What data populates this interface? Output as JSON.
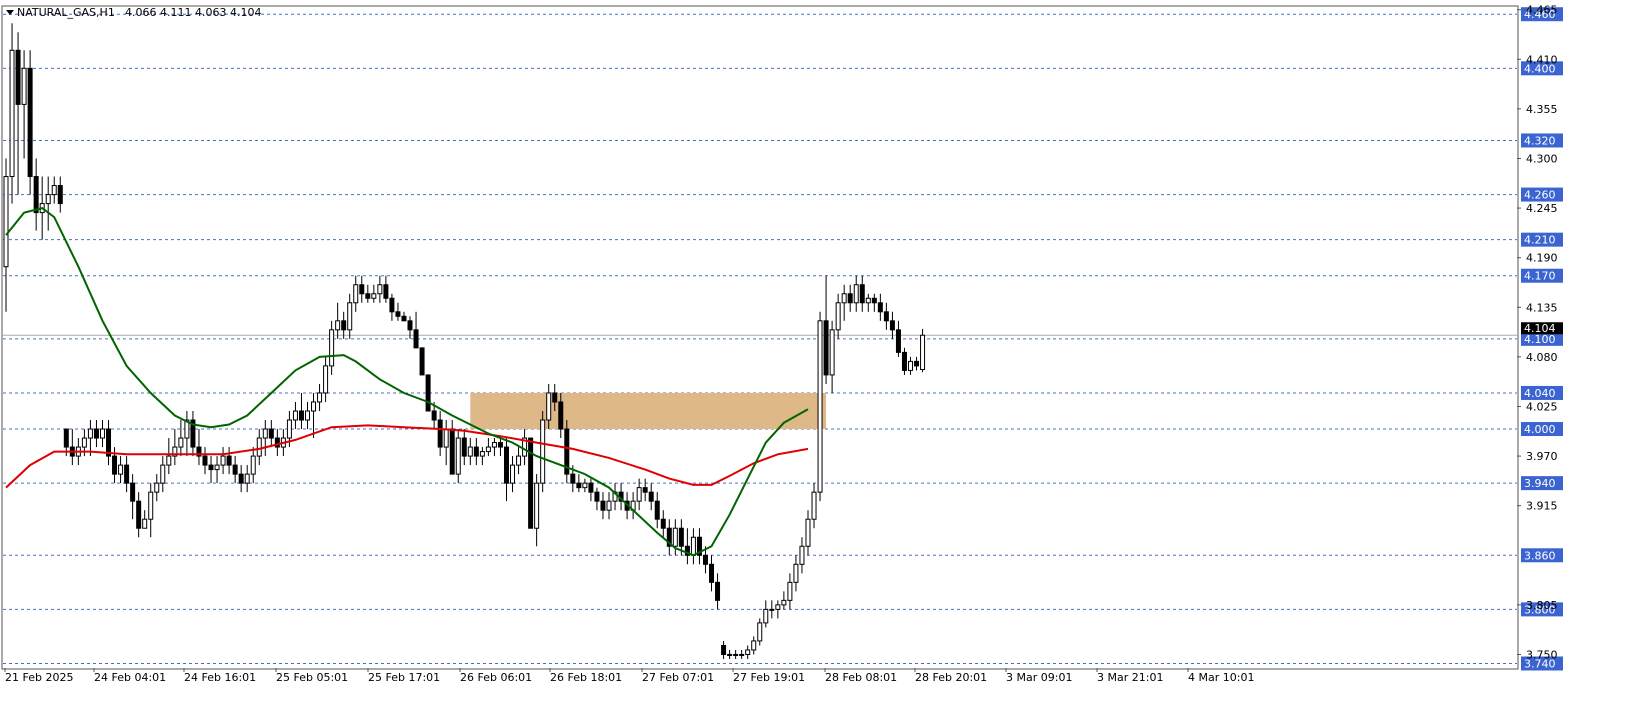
{
  "chart_data": {
    "type": "candlestick",
    "header": {
      "symbol_timeframe": "NATURAL_GAS,H1",
      "open": "4.066",
      "high": "4.111",
      "low": "4.063",
      "close": "4.104",
      "dropdown_icon": "triangle-down-icon"
    },
    "current_price": "4.104",
    "ylim": [
      3.735,
      4.468
    ],
    "y_ticks": [
      "4.465",
      "4.410",
      "4.355",
      "4.300",
      "4.245",
      "4.190",
      "4.135",
      "4.080",
      "4.025",
      "3.970",
      "3.915",
      "3.805",
      "3.750"
    ],
    "horizontal_levels": [
      {
        "value": 4.46,
        "label": "4.460"
      },
      {
        "value": 4.4,
        "label": "4.400"
      },
      {
        "value": 4.32,
        "label": "4.320"
      },
      {
        "value": 4.26,
        "label": "4.260"
      },
      {
        "value": 4.21,
        "label": "4.210"
      },
      {
        "value": 4.17,
        "label": "4.170"
      },
      {
        "value": 4.1,
        "label": "4.100"
      },
      {
        "value": 4.04,
        "label": "4.040"
      },
      {
        "value": 4.0,
        "label": "4.000"
      },
      {
        "value": 3.94,
        "label": "3.940"
      },
      {
        "value": 3.86,
        "label": "3.860"
      },
      {
        "value": 3.8,
        "label": "3.800"
      },
      {
        "value": 3.74,
        "label": "3.740"
      }
    ],
    "x_labels": [
      "21 Feb 2025",
      "24 Feb 04:01",
      "24 Feb 16:01",
      "25 Feb 05:01",
      "25 Feb 17:01",
      "26 Feb 06:01",
      "26 Feb 18:01",
      "27 Feb 07:01",
      "27 Feb 19:01",
      "28 Feb 08:01",
      "28 Feb 20:01",
      "3 Mar 09:01",
      "3 Mar 21:01",
      "4 Mar 10:01"
    ],
    "zone": {
      "from": 4.0,
      "to": 4.04,
      "start_bar": 77,
      "end_bar": 136,
      "color": "#deb887"
    },
    "ma_fast": {
      "color": "#006400",
      "points": [
        [
          0,
          4.215
        ],
        [
          3,
          4.24
        ],
        [
          6,
          4.245
        ],
        [
          8,
          4.235
        ],
        [
          12,
          4.18
        ],
        [
          16,
          4.12
        ],
        [
          20,
          4.07
        ],
        [
          24,
          4.04
        ],
        [
          28,
          4.015
        ],
        [
          31,
          4.005
        ],
        [
          34,
          4.002
        ],
        [
          37,
          4.005
        ],
        [
          40,
          4.015
        ],
        [
          44,
          4.04
        ],
        [
          48,
          4.065
        ],
        [
          52,
          4.08
        ],
        [
          56,
          4.082
        ],
        [
          58,
          4.075
        ],
        [
          62,
          4.055
        ],
        [
          66,
          4.04
        ],
        [
          70,
          4.03
        ],
        [
          74,
          4.015
        ],
        [
          77,
          4.005
        ],
        [
          80,
          3.995
        ],
        [
          84,
          3.985
        ],
        [
          88,
          3.97
        ],
        [
          92,
          3.96
        ],
        [
          96,
          3.95
        ],
        [
          100,
          3.935
        ],
        [
          104,
          3.91
        ],
        [
          108,
          3.885
        ],
        [
          111,
          3.868
        ],
        [
          114,
          3.86
        ],
        [
          117,
          3.87
        ],
        [
          120,
          3.905
        ],
        [
          123,
          3.945
        ],
        [
          126,
          3.985
        ],
        [
          129,
          4.007
        ],
        [
          133,
          4.022
        ]
      ]
    },
    "ma_slow": {
      "color": "#e00000",
      "points": [
        [
          0,
          3.935
        ],
        [
          4,
          3.96
        ],
        [
          8,
          3.975
        ],
        [
          14,
          3.975
        ],
        [
          20,
          3.972
        ],
        [
          28,
          3.972
        ],
        [
          36,
          3.972
        ],
        [
          42,
          3.978
        ],
        [
          48,
          3.988
        ],
        [
          54,
          4.002
        ],
        [
          60,
          4.004
        ],
        [
          66,
          4.002
        ],
        [
          72,
          4.0
        ],
        [
          76,
          3.998
        ],
        [
          82,
          3.992
        ],
        [
          88,
          3.985
        ],
        [
          94,
          3.978
        ],
        [
          100,
          3.968
        ],
        [
          106,
          3.955
        ],
        [
          110,
          3.945
        ],
        [
          114,
          3.938
        ],
        [
          117,
          3.938
        ],
        [
          120,
          3.948
        ],
        [
          124,
          3.962
        ],
        [
          128,
          3.972
        ],
        [
          133,
          3.978
        ]
      ]
    },
    "candles": [
      [
        4.18,
        4.3,
        4.13,
        4.28
      ],
      [
        4.28,
        4.45,
        4.25,
        4.42
      ],
      [
        4.42,
        4.44,
        4.26,
        4.36
      ],
      [
        4.36,
        4.42,
        4.3,
        4.4
      ],
      [
        4.4,
        4.42,
        4.26,
        4.28
      ],
      [
        4.28,
        4.3,
        4.22,
        4.24
      ],
      [
        4.24,
        4.28,
        4.21,
        4.25
      ],
      [
        4.25,
        4.28,
        4.22,
        4.26
      ],
      [
        4.26,
        4.28,
        4.25,
        4.27
      ],
      [
        4.27,
        4.28,
        4.24,
        4.25
      ],
      [
        4.0,
        4.0,
        3.97,
        3.98
      ],
      [
        3.98,
        4.0,
        3.96,
        3.97
      ],
      [
        3.97,
        3.99,
        3.96,
        3.98
      ],
      [
        3.98,
        4.0,
        3.97,
        3.99
      ],
      [
        3.99,
        4.01,
        3.97,
        4.0
      ],
      [
        4.0,
        4.01,
        3.98,
        3.99
      ],
      [
        3.99,
        4.01,
        3.98,
        4.0
      ],
      [
        4.0,
        4.01,
        3.96,
        3.97
      ],
      [
        3.97,
        3.98,
        3.94,
        3.95
      ],
      [
        3.95,
        3.97,
        3.94,
        3.96
      ],
      [
        3.96,
        3.97,
        3.93,
        3.94
      ],
      [
        3.94,
        3.95,
        3.9,
        3.92
      ],
      [
        3.92,
        3.93,
        3.88,
        3.89
      ],
      [
        3.89,
        3.91,
        3.89,
        3.9
      ],
      [
        3.9,
        3.94,
        3.88,
        3.93
      ],
      [
        3.93,
        3.95,
        3.92,
        3.94
      ],
      [
        3.94,
        3.97,
        3.93,
        3.96
      ],
      [
        3.96,
        3.99,
        3.95,
        3.97
      ],
      [
        3.97,
        4.0,
        3.96,
        3.98
      ],
      [
        3.98,
        4.01,
        3.97,
        3.99
      ],
      [
        3.99,
        4.02,
        3.97,
        4.01
      ],
      [
        4.01,
        4.02,
        3.97,
        3.98
      ],
      [
        3.98,
        4.0,
        3.96,
        3.97
      ],
      [
        3.97,
        3.98,
        3.95,
        3.96
      ],
      [
        3.96,
        3.97,
        3.94,
        3.955
      ],
      [
        3.955,
        3.97,
        3.94,
        3.96
      ],
      [
        3.96,
        3.98,
        3.95,
        3.97
      ],
      [
        3.97,
        3.98,
        3.95,
        3.96
      ],
      [
        3.96,
        3.97,
        3.94,
        3.95
      ],
      [
        3.95,
        3.96,
        3.93,
        3.94
      ],
      [
        3.94,
        3.96,
        3.93,
        3.95
      ],
      [
        3.95,
        3.98,
        3.94,
        3.97
      ],
      [
        3.97,
        4.0,
        3.96,
        3.99
      ],
      [
        3.99,
        4.01,
        3.97,
        4.0
      ],
      [
        4.0,
        4.01,
        3.98,
        3.99
      ],
      [
        3.99,
        4.0,
        3.97,
        3.98
      ],
      [
        3.98,
        4.0,
        3.97,
        3.99
      ],
      [
        3.99,
        4.02,
        3.98,
        4.01
      ],
      [
        4.01,
        4.03,
        4.0,
        4.02
      ],
      [
        4.02,
        4.04,
        4.0,
        4.01
      ],
      [
        4.01,
        4.03,
        4.0,
        4.02
      ],
      [
        4.02,
        4.04,
        3.99,
        4.03
      ],
      [
        4.03,
        4.05,
        4.02,
        4.04
      ],
      [
        4.04,
        4.08,
        4.03,
        4.07
      ],
      [
        4.07,
        4.12,
        4.06,
        4.11
      ],
      [
        4.11,
        4.14,
        4.1,
        4.12
      ],
      [
        4.12,
        4.13,
        4.1,
        4.11
      ],
      [
        4.11,
        4.15,
        4.1,
        4.14
      ],
      [
        4.14,
        4.17,
        4.13,
        4.16
      ],
      [
        4.16,
        4.17,
        4.14,
        4.15
      ],
      [
        4.15,
        4.16,
        4.14,
        4.145
      ],
      [
        4.145,
        4.16,
        4.14,
        4.15
      ],
      [
        4.15,
        4.17,
        4.14,
        4.16
      ],
      [
        4.16,
        4.17,
        4.14,
        4.145
      ],
      [
        4.145,
        4.15,
        4.12,
        4.13
      ],
      [
        4.13,
        4.14,
        4.12,
        4.125
      ],
      [
        4.125,
        4.13,
        4.12,
        4.12
      ],
      [
        4.12,
        4.125,
        4.1,
        4.11
      ],
      [
        4.11,
        4.13,
        4.09,
        4.09
      ],
      [
        4.09,
        4.09,
        4.06,
        4.06
      ],
      [
        4.06,
        4.06,
        4.02,
        4.02
      ],
      [
        4.02,
        4.03,
        4.0,
        4.01
      ],
      [
        4.01,
        4.02,
        3.97,
        3.98
      ],
      [
        3.98,
        4.01,
        3.96,
        4.0
      ],
      [
        4.0,
        4.01,
        3.95,
        3.95
      ],
      [
        3.95,
        4.0,
        3.94,
        3.99
      ],
      [
        3.99,
        4.0,
        3.96,
        3.97
      ],
      [
        3.97,
        3.99,
        3.96,
        3.98
      ],
      [
        3.98,
        3.99,
        3.96,
        3.97
      ],
      [
        3.97,
        3.98,
        3.96,
        3.975
      ],
      [
        3.975,
        3.99,
        3.97,
        3.98
      ],
      [
        3.98,
        3.99,
        3.97,
        3.985
      ],
      [
        3.985,
        3.99,
        3.97,
        3.98
      ],
      [
        3.98,
        3.99,
        3.92,
        3.94
      ],
      [
        3.94,
        3.97,
        3.93,
        3.96
      ],
      [
        3.96,
        3.98,
        3.95,
        3.97
      ],
      [
        3.97,
        4.0,
        3.96,
        3.99
      ],
      [
        3.99,
        3.99,
        3.92,
        3.89
      ],
      [
        3.89,
        3.95,
        3.87,
        3.94
      ],
      [
        3.94,
        4.02,
        3.93,
        4.01
      ],
      [
        4.01,
        4.05,
        4.0,
        4.04
      ],
      [
        4.04,
        4.05,
        4.02,
        4.03
      ],
      [
        4.03,
        4.04,
        3.99,
        4.0
      ],
      [
        4.0,
        4.01,
        3.94,
        3.95
      ],
      [
        3.95,
        3.96,
        3.93,
        3.94
      ],
      [
        3.94,
        3.95,
        3.93,
        3.935
      ],
      [
        3.935,
        3.945,
        3.93,
        3.94
      ],
      [
        3.94,
        3.945,
        3.92,
        3.93
      ],
      [
        3.93,
        3.935,
        3.91,
        3.92
      ],
      [
        3.92,
        3.93,
        3.9,
        3.91
      ],
      [
        3.91,
        3.93,
        3.9,
        3.92
      ],
      [
        3.92,
        3.94,
        3.91,
        3.93
      ],
      [
        3.93,
        3.94,
        3.91,
        3.92
      ],
      [
        3.92,
        3.93,
        3.9,
        3.91
      ],
      [
        3.91,
        3.93,
        3.9,
        3.92
      ],
      [
        3.92,
        3.945,
        3.91,
        3.935
      ],
      [
        3.935,
        3.945,
        3.92,
        3.93
      ],
      [
        3.93,
        3.94,
        3.91,
        3.92
      ],
      [
        3.92,
        3.93,
        3.89,
        3.9
      ],
      [
        3.9,
        3.91,
        3.88,
        3.89
      ],
      [
        3.89,
        3.9,
        3.86,
        3.87
      ],
      [
        3.87,
        3.9,
        3.86,
        3.89
      ],
      [
        3.89,
        3.9,
        3.86,
        3.87
      ],
      [
        3.87,
        3.89,
        3.85,
        3.86
      ],
      [
        3.86,
        3.89,
        3.85,
        3.88
      ],
      [
        3.88,
        3.89,
        3.85,
        3.86
      ],
      [
        3.86,
        3.87,
        3.84,
        3.85
      ],
      [
        3.85,
        3.86,
        3.82,
        3.83
      ],
      [
        3.83,
        3.84,
        3.8,
        3.81
      ],
      [
        3.76,
        3.765,
        3.745,
        3.75
      ],
      [
        3.75,
        3.755,
        3.745,
        3.75
      ],
      [
        3.75,
        3.755,
        3.745,
        3.75
      ],
      [
        3.75,
        3.755,
        3.745,
        3.75
      ],
      [
        3.75,
        3.76,
        3.745,
        3.755
      ],
      [
        3.755,
        3.77,
        3.75,
        3.765
      ],
      [
        3.765,
        3.79,
        3.76,
        3.785
      ],
      [
        3.785,
        3.81,
        3.78,
        3.8
      ],
      [
        3.8,
        3.81,
        3.79,
        3.8
      ],
      [
        3.8,
        3.81,
        3.79,
        3.805
      ],
      [
        3.805,
        3.82,
        3.8,
        3.81
      ],
      [
        3.81,
        3.84,
        3.8,
        3.83
      ],
      [
        3.83,
        3.86,
        3.82,
        3.85
      ],
      [
        3.85,
        3.88,
        3.84,
        3.87
      ],
      [
        3.87,
        3.91,
        3.86,
        3.9
      ],
      [
        3.9,
        3.94,
        3.89,
        3.93
      ],
      [
        3.93,
        4.13,
        3.92,
        4.12
      ],
      [
        4.12,
        4.17,
        4.05,
        4.06
      ],
      [
        4.06,
        4.12,
        4.04,
        4.11
      ],
      [
        4.11,
        4.15,
        4.1,
        4.14
      ],
      [
        4.14,
        4.16,
        4.12,
        4.15
      ],
      [
        4.15,
        4.16,
        4.13,
        4.14
      ],
      [
        4.14,
        4.17,
        4.13,
        4.16
      ],
      [
        4.16,
        4.17,
        4.13,
        4.14
      ],
      [
        4.14,
        4.15,
        4.13,
        4.145
      ],
      [
        4.145,
        4.15,
        4.13,
        4.14
      ],
      [
        4.14,
        4.15,
        4.12,
        4.13
      ],
      [
        4.13,
        4.14,
        4.11,
        4.12
      ],
      [
        4.12,
        4.13,
        4.1,
        4.11
      ],
      [
        4.11,
        4.12,
        4.08,
        4.085
      ],
      [
        4.085,
        4.09,
        4.06,
        4.065
      ],
      [
        4.065,
        4.08,
        4.06,
        4.075
      ],
      [
        4.075,
        4.08,
        4.065,
        4.07
      ],
      [
        4.066,
        4.111,
        4.063,
        4.104
      ]
    ]
  }
}
